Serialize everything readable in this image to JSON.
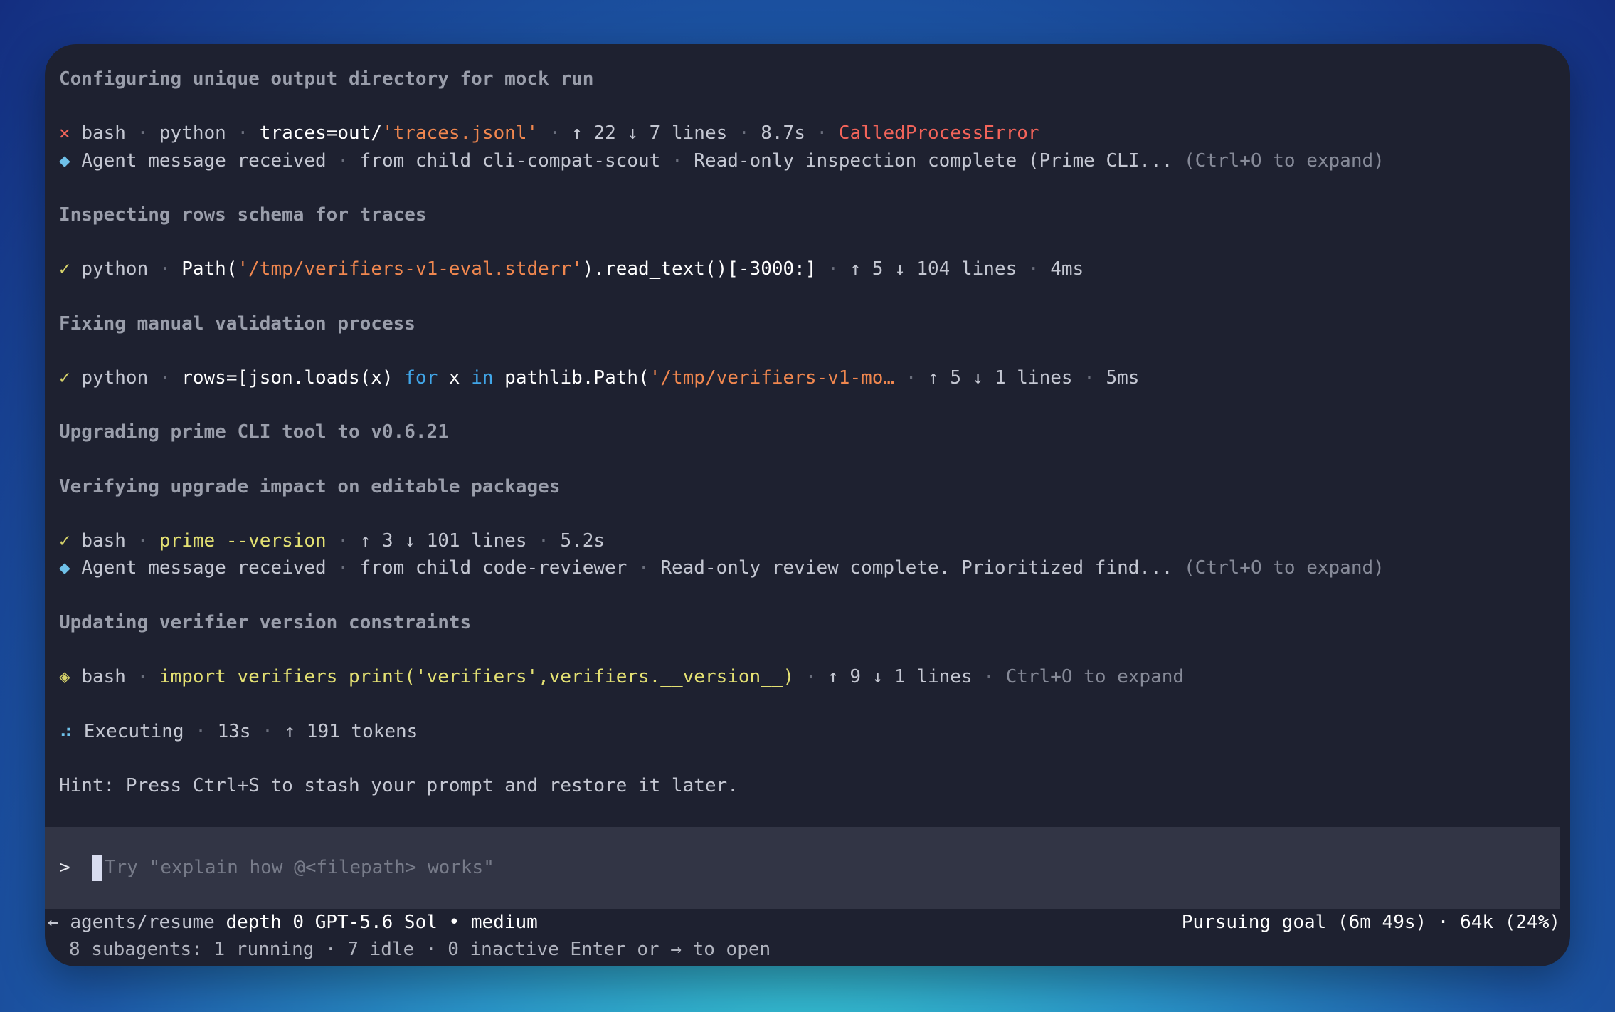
{
  "lines": [
    {
      "kind": "heading",
      "text": "Configuring unique output directory for mock run"
    },
    {
      "kind": "blank"
    },
    {
      "kind": "tool",
      "icon": "x-icon",
      "glyph": "✕",
      "parts": [
        {
          "t": "bash",
          "c": "text"
        },
        {
          "t": " · ",
          "c": "sep"
        },
        {
          "t": "python",
          "c": "text"
        },
        {
          "t": " · ",
          "c": "sep"
        },
        {
          "t": "traces=out/",
          "c": "bright"
        },
        {
          "t": "'traces.jsonl'",
          "c": "str"
        },
        {
          "t": " · ",
          "c": "sep"
        },
        {
          "t": "↑ 22 ↓ 7 lines",
          "c": "text"
        },
        {
          "t": " · ",
          "c": "sep"
        },
        {
          "t": "8.7s",
          "c": "text"
        },
        {
          "t": " · ",
          "c": "sep"
        },
        {
          "t": "CalledProcessError",
          "c": "err"
        }
      ]
    },
    {
      "kind": "tool",
      "icon": "diamond-icon",
      "glyph": "◆",
      "parts": [
        {
          "t": "Agent message received",
          "c": "text"
        },
        {
          "t": " · ",
          "c": "sep"
        },
        {
          "t": "from child cli-compat-scout",
          "c": "text"
        },
        {
          "t": " · ",
          "c": "sep"
        },
        {
          "t": "Read-only inspection complete (Prime CLI...",
          "c": "text"
        },
        {
          "t": " (Ctrl+O to expand)",
          "c": "dim"
        }
      ]
    },
    {
      "kind": "blank"
    },
    {
      "kind": "heading",
      "text": "Inspecting rows schema for traces"
    },
    {
      "kind": "blank"
    },
    {
      "kind": "tool",
      "icon": "check-icon",
      "glyph": "✓",
      "parts": [
        {
          "t": "python",
          "c": "text"
        },
        {
          "t": " · ",
          "c": "sep"
        },
        {
          "t": "Path(",
          "c": "bright"
        },
        {
          "t": "'/tmp/verifiers-v1-eval.stderr'",
          "c": "str"
        },
        {
          "t": ").read_text()[-3000:]",
          "c": "bright"
        },
        {
          "t": " · ",
          "c": "sep"
        },
        {
          "t": "↑ 5 ↓ 104 lines",
          "c": "text"
        },
        {
          "t": " · ",
          "c": "sep"
        },
        {
          "t": "4ms",
          "c": "text"
        }
      ]
    },
    {
      "kind": "blank"
    },
    {
      "kind": "heading",
      "text": "Fixing manual validation process"
    },
    {
      "kind": "blank"
    },
    {
      "kind": "tool",
      "icon": "check-icon",
      "glyph": "✓",
      "parts": [
        {
          "t": "python",
          "c": "text"
        },
        {
          "t": " · ",
          "c": "sep"
        },
        {
          "t": "rows=[json.loads(x) ",
          "c": "bright"
        },
        {
          "t": "for",
          "c": "kw"
        },
        {
          "t": " x ",
          "c": "bright"
        },
        {
          "t": "in",
          "c": "kw"
        },
        {
          "t": " pathlib.Path(",
          "c": "bright"
        },
        {
          "t": "'/tmp/verifiers-v1-mo…",
          "c": "str"
        },
        {
          "t": " · ",
          "c": "sep"
        },
        {
          "t": "↑ 5 ↓ 1 lines",
          "c": "text"
        },
        {
          "t": " · ",
          "c": "sep"
        },
        {
          "t": "5ms",
          "c": "text"
        }
      ]
    },
    {
      "kind": "blank"
    },
    {
      "kind": "heading",
      "text": "Upgrading prime CLI tool to v0.6.21"
    },
    {
      "kind": "blank"
    },
    {
      "kind": "heading",
      "text": "Verifying upgrade impact on editable packages"
    },
    {
      "kind": "blank"
    },
    {
      "kind": "tool",
      "icon": "check-icon",
      "glyph": "✓",
      "parts": [
        {
          "t": "bash",
          "c": "text"
        },
        {
          "t": " · ",
          "c": "sep"
        },
        {
          "t": "prime --version",
          "c": "yellow"
        },
        {
          "t": " · ",
          "c": "sep"
        },
        {
          "t": "↑ 3 ↓ 101 lines",
          "c": "text"
        },
        {
          "t": " · ",
          "c": "sep"
        },
        {
          "t": "5.2s",
          "c": "text"
        }
      ]
    },
    {
      "kind": "tool",
      "icon": "diamond-icon",
      "glyph": "◆",
      "parts": [
        {
          "t": "Agent message received",
          "c": "text"
        },
        {
          "t": " · ",
          "c": "sep"
        },
        {
          "t": "from child code-reviewer",
          "c": "text"
        },
        {
          "t": " · ",
          "c": "sep"
        },
        {
          "t": "Read-only review complete. Prioritized find...",
          "c": "text"
        },
        {
          "t": " (Ctrl+O to expand)",
          "c": "dim"
        }
      ]
    },
    {
      "kind": "blank"
    },
    {
      "kind": "heading",
      "text": "Updating verifier version constraints"
    },
    {
      "kind": "blank"
    },
    {
      "kind": "tool",
      "icon": "pending-icon",
      "glyph": "◈",
      "parts": [
        {
          "t": "bash",
          "c": "text"
        },
        {
          "t": " · ",
          "c": "sep"
        },
        {
          "t": "import verifiers print('verifiers',verifiers.__version__)",
          "c": "yellow"
        },
        {
          "t": " · ",
          "c": "sep"
        },
        {
          "t": "↑ 9 ↓ 1 lines",
          "c": "text"
        },
        {
          "t": " · ",
          "c": "sep"
        },
        {
          "t": "Ctrl+O to expand",
          "c": "dim"
        }
      ]
    },
    {
      "kind": "blank"
    },
    {
      "kind": "tool",
      "icon": "spinner-icon",
      "glyph": "⠴",
      "parts": [
        {
          "t": "Executing",
          "c": "text"
        },
        {
          "t": " · ",
          "c": "sep"
        },
        {
          "t": "13s",
          "c": "text"
        },
        {
          "t": " · ",
          "c": "sep"
        },
        {
          "t": "↑ 191 tokens",
          "c": "text"
        }
      ]
    },
    {
      "kind": "blank"
    },
    {
      "kind": "hint",
      "text": "Hint: Press Ctrl+S to stash your prompt and restore it later."
    }
  ],
  "prompt": {
    "caret": ">",
    "placeholder": "Try \"explain how @<filepath> works\""
  },
  "status": {
    "back_arrow": "←",
    "path": "agents/resume",
    "depth": "depth 0",
    "model": "GPT-5.6 Sol • medium",
    "goal": "Pursuing goal (6m 49s) · 64k (24%)",
    "subagents": "8 subagents: 1 running · 7 idle · 0 inactive",
    "open_hint": "Enter or → to open"
  },
  "colors": {
    "window_bg": "#1e2130",
    "prompt_bg": "#323545",
    "error": "#f3645a",
    "success": "#d7d36a",
    "info": "#6fc1e9",
    "string": "#f0874f",
    "keyword": "#41a6e8"
  }
}
